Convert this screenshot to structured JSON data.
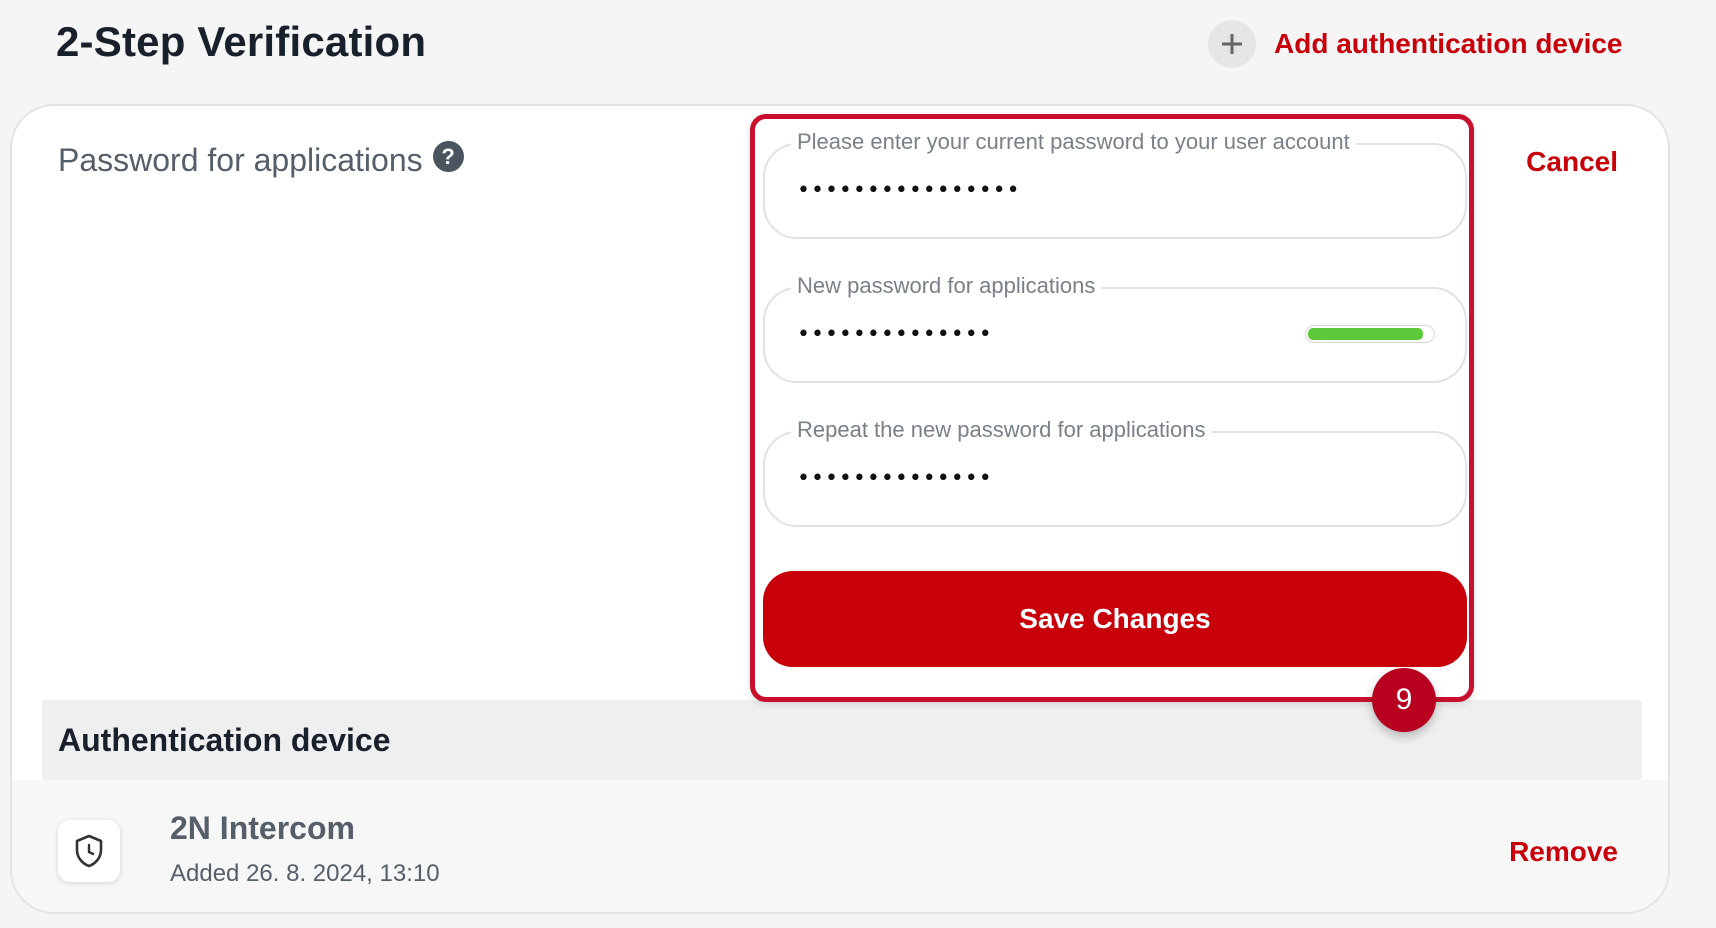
{
  "header": {
    "title": "2-Step Verification",
    "add_device_label": "Add authentication device",
    "add_icon": "plus-icon"
  },
  "password_section": {
    "title": "Password for applications",
    "help_icon": "question-icon",
    "help_glyph": "?",
    "cancel_label": "Cancel"
  },
  "form": {
    "current_password": {
      "label": "Please enter your current password to your user account",
      "value": "••••••••••••••••"
    },
    "new_password": {
      "label": "New password for applications",
      "value": "••••••••••••••",
      "strength_fraction": 0.93,
      "strength_color": "#5cc93b"
    },
    "repeat_password": {
      "label": "Repeat the new password for applications",
      "value": "••••••••••••••"
    },
    "save_label": "Save Changes"
  },
  "step_badge": "9",
  "auth_devices": {
    "section_title": "Authentication device",
    "items": [
      {
        "icon": "shield-clock-icon",
        "name": "2N Intercom",
        "added": "Added 26. 8. 2024, 13:10",
        "remove_label": "Remove"
      }
    ]
  },
  "colors": {
    "accent": "#c8000a",
    "highlight_border": "#c8102e",
    "badge": "#b80020"
  }
}
